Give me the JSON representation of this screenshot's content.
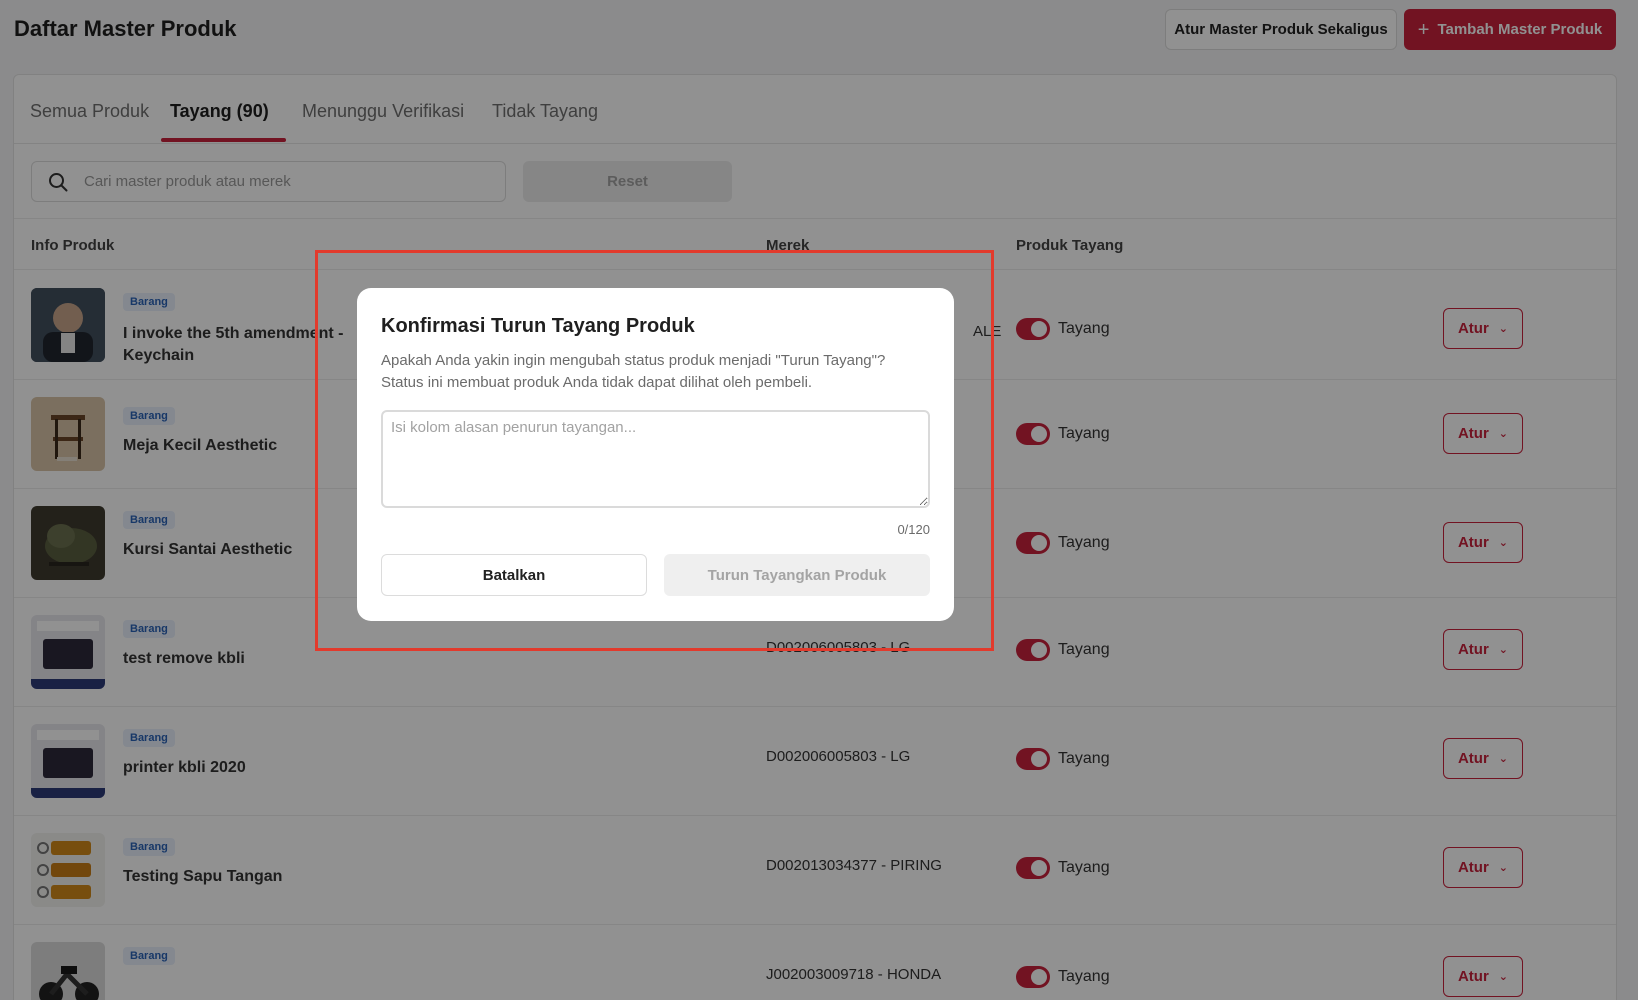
{
  "header": {
    "title": "Daftar Master Produk",
    "bulk_label": "Atur Master Produk Sekaligus",
    "add_label": "Tambah Master Produk"
  },
  "tabs": [
    {
      "label": "Semua Produk"
    },
    {
      "label": "Tayang (90)"
    },
    {
      "label": "Menunggu Verifikasi"
    },
    {
      "label": "Tidak Tayang"
    }
  ],
  "active_tab": "Tayang (90)",
  "search": {
    "placeholder": "Cari master produk atau merek",
    "value": ""
  },
  "reset_label": "Reset",
  "table": {
    "headers": [
      "Info Produk",
      "Merek",
      "Produk Tayang"
    ],
    "rows": [
      {
        "badge": "Barang",
        "name": "I invoke the 5th amendment - Keychain",
        "brand": "ALE",
        "status": "Tayang",
        "action": "Atur"
      },
      {
        "badge": "Barang",
        "name": "Meja Kecil Aesthetic",
        "brand": "",
        "status": "Tayang",
        "action": "Atur"
      },
      {
        "badge": "Barang",
        "name": "Kursi Santai Aesthetic",
        "brand": "",
        "status": "Tayang",
        "action": "Atur"
      },
      {
        "badge": "Barang",
        "name": "test remove kbli",
        "brand": "D002006005803 - LG",
        "status": "Tayang",
        "action": "Atur"
      },
      {
        "badge": "Barang",
        "name": "printer kbli 2020",
        "brand": "D002006005803 - LG",
        "status": "Tayang",
        "action": "Atur"
      },
      {
        "badge": "Barang",
        "name": "Testing Sapu Tangan",
        "brand": "D002013034377 - PIRING",
        "status": "Tayang",
        "action": "Atur"
      },
      {
        "badge": "Barang",
        "name": "",
        "brand": "J002003009718 - HONDA",
        "status": "Tayang",
        "action": "Atur"
      }
    ]
  },
  "modal": {
    "title": "Konfirmasi Turun Tayang Produk",
    "description": "Apakah Anda yakin ingin mengubah status produk menjadi \"Turun Tayang\"? Status ini membuat produk Anda tidak dapat dilihat oleh pembeli.",
    "reason_placeholder": "Isi kolom alasan penurun tayangan...",
    "reason_value": "",
    "counter": "0/120",
    "cancel_label": "Batalkan",
    "confirm_label": "Turun Tayangkan Produk"
  },
  "colors": {
    "brand": "#c9223d",
    "highlight": "#e23a2c",
    "badge_text": "#2b63b7"
  }
}
